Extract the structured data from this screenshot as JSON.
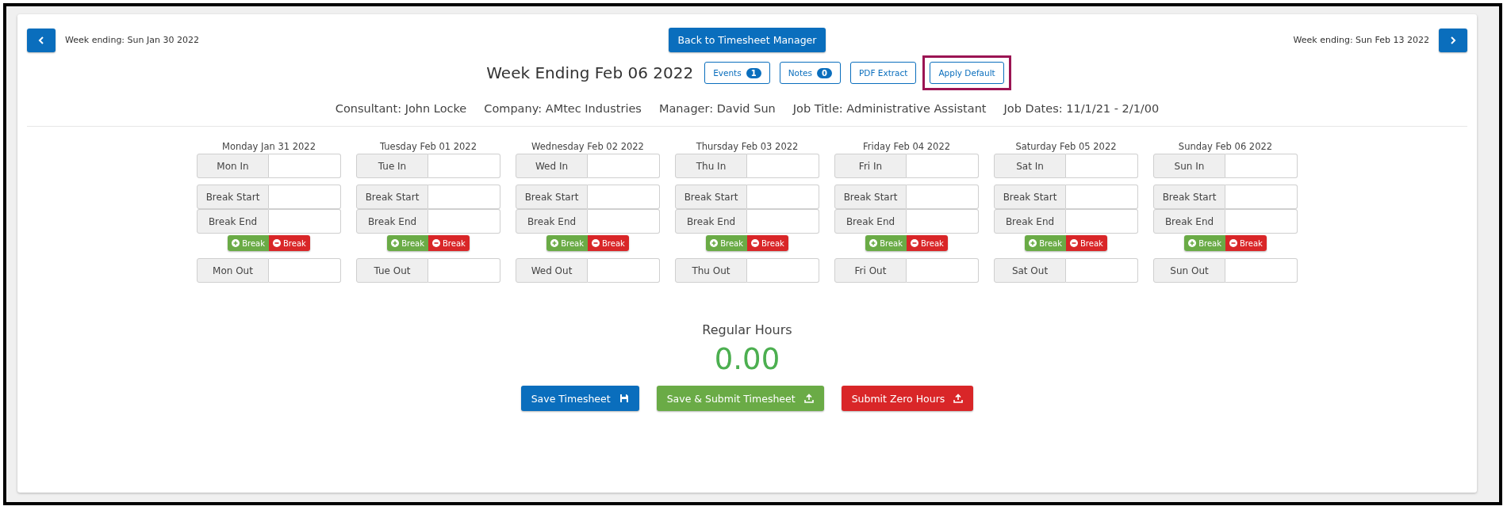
{
  "nav": {
    "previous_label": "Week ending: Sun Jan 30 2022",
    "back_button": "Back to Timesheet Manager",
    "next_label": "Week ending: Sun Feb 13 2022"
  },
  "title": "Week Ending Feb 06 2022",
  "header_buttons": [
    {
      "label": "Events",
      "badge": "1",
      "highlighted": false
    },
    {
      "label": "Notes",
      "badge": "0",
      "highlighted": false
    },
    {
      "label": "PDF Extract",
      "highlighted": false
    },
    {
      "label": "Apply Default",
      "highlighted": true
    }
  ],
  "info": [
    "Consultant: John Locke",
    "Company: AMtec Industries",
    "Manager: David Sun",
    "Job Title: Administrative Assistant",
    "Job Dates: 11/1/21 - 2/1/00"
  ],
  "days": [
    {
      "header": "Monday Jan 31 2022",
      "clock_in": "Mon In",
      "break_fields": [
        "Break Start",
        "Break End"
      ],
      "break_buttons": [
        {
          "label": "Break",
          "kind": "add"
        },
        {
          "label": "Break",
          "kind": "remove"
        }
      ],
      "clock_out": "Mon Out"
    },
    {
      "header": "Tuesday Feb 01 2022",
      "clock_in": "Tue In",
      "break_fields": [
        "Break Start",
        "Break End"
      ],
      "break_buttons": [
        {
          "label": "Break",
          "kind": "add"
        },
        {
          "label": "Break",
          "kind": "remove"
        }
      ],
      "clock_out": "Tue Out"
    },
    {
      "header": "Wednesday Feb 02 2022",
      "clock_in": "Wed In",
      "break_fields": [
        "Break Start",
        "Break End"
      ],
      "break_buttons": [
        {
          "label": "Break",
          "kind": "add"
        },
        {
          "label": "Break",
          "kind": "remove"
        }
      ],
      "clock_out": "Wed Out"
    },
    {
      "header": "Thursday Feb 03 2022",
      "clock_in": "Thu In",
      "break_fields": [
        "Break Start",
        "Break End"
      ],
      "break_buttons": [
        {
          "label": "Break",
          "kind": "add"
        },
        {
          "label": "Break",
          "kind": "remove"
        }
      ],
      "clock_out": "Thu Out"
    },
    {
      "header": "Friday Feb 04 2022",
      "clock_in": "Fri In",
      "break_fields": [
        "Break Start",
        "Break End"
      ],
      "break_buttons": [
        {
          "label": "Break",
          "kind": "add"
        },
        {
          "label": "Break",
          "kind": "remove"
        }
      ],
      "clock_out": "Fri Out"
    },
    {
      "header": "Saturday Feb 05 2022",
      "clock_in": "Sat In",
      "break_fields": [
        "Break Start",
        "Break End"
      ],
      "break_buttons": [
        {
          "label": "Break",
          "kind": "add"
        },
        {
          "label": "Break",
          "kind": "remove"
        }
      ],
      "clock_out": "Sat Out"
    },
    {
      "header": "Sunday Feb 06 2022",
      "clock_in": "Sun In",
      "break_fields": [
        "Break Start",
        "Break End"
      ],
      "break_buttons": [
        {
          "label": "Break",
          "kind": "add"
        },
        {
          "label": "Break",
          "kind": "remove"
        }
      ],
      "clock_out": "Sun Out"
    }
  ],
  "totals": {
    "label": "Regular Hours",
    "value": "0.00"
  },
  "actions": [
    {
      "label": "Save Timesheet",
      "color": "#0a6ebd",
      "kind": "save"
    },
    {
      "label": "Save & Submit Timesheet",
      "color": "#6aab46",
      "kind": "upload"
    },
    {
      "label": "Submit Zero Hours",
      "color": "#d92628",
      "kind": "upload"
    }
  ]
}
